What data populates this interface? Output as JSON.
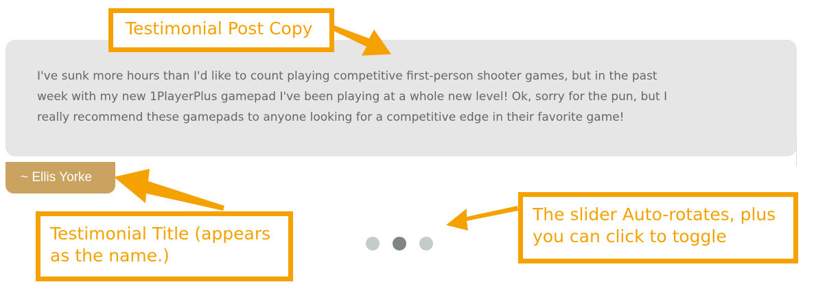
{
  "testimonial": {
    "copy_line_1": "I've sunk more hours than I'd like to count playing competitive first-person shooter games, but in the past",
    "copy_line_2": "week with my new 1PlayerPlus gamepad I've been playing at a whole new level! Ok, sorry for the pun, but I",
    "copy_line_3": "really recommend these gamepads to anyone looking for a competitive edge in their favorite game!",
    "author": "~ Ellis Yorke"
  },
  "slider": {
    "dots": [
      {
        "active": false
      },
      {
        "active": true
      },
      {
        "active": false
      }
    ]
  },
  "annotations": {
    "post_copy": "Testimonial Post Copy",
    "title_line_1": "Testimonial Title (appears",
    "title_line_2": "as the name.)",
    "slider_line_1": "The slider Auto-rotates, plus",
    "slider_line_2": "you can click to toggle"
  },
  "colors": {
    "box_background": "#e6e6e6",
    "name_tag": "#c9a35f",
    "annotation_orange": "#f5a200",
    "dot_inactive": "#c3cccb",
    "dot_active": "#7e8584"
  }
}
